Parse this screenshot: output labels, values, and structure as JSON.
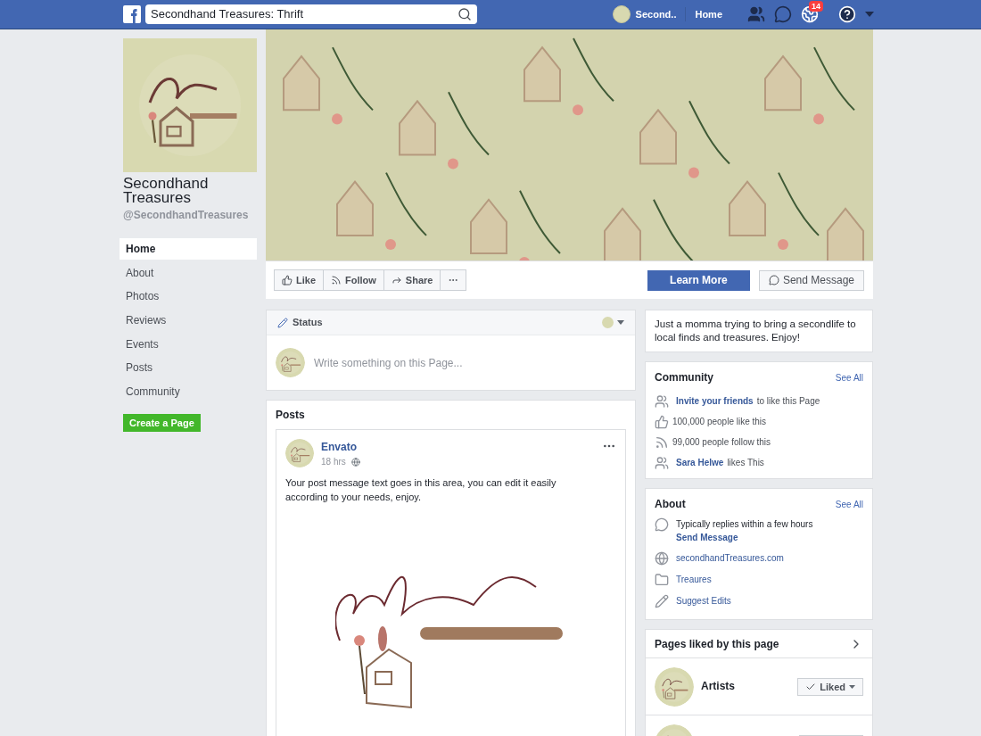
{
  "topbar": {
    "search_value": "Secondhand Treasures: Thrift",
    "profile_name": "Second..",
    "home": "Home",
    "notification_count": "14"
  },
  "page": {
    "name": "Secondhand Treasures",
    "handle": "@SecondhandTreasures",
    "create_button": "Create a Page"
  },
  "nav": [
    {
      "label": "Home",
      "selected": true
    },
    {
      "label": "About",
      "selected": false
    },
    {
      "label": "Photos",
      "selected": false
    },
    {
      "label": "Reviews",
      "selected": false
    },
    {
      "label": "Events",
      "selected": false
    },
    {
      "label": "Posts",
      "selected": false
    },
    {
      "label": "Community",
      "selected": false
    }
  ],
  "actions": {
    "buttons": [
      {
        "kind": "like",
        "label": "Like"
      },
      {
        "kind": "follow",
        "label": "Follow"
      },
      {
        "kind": "share",
        "label": "Share"
      },
      {
        "kind": "more"
      }
    ],
    "learn_more": "Learn More",
    "send_message": "Send Message"
  },
  "status": {
    "label": "Status",
    "placeholder": "Write something on this Page..."
  },
  "posts": {
    "title": "Posts",
    "post": {
      "author": "Envato",
      "time": "18 hrs",
      "text": "Your post message text goes in this area, you can edit it easily according to your needs, enjoy."
    }
  },
  "blurb": "Just a momma trying to bring a secondlife to local finds and treasures. Enjoy!",
  "community": {
    "title": "Community",
    "see_all": "See All",
    "rows": [
      {
        "kind": "people",
        "link": "Invite your friends",
        "text": "to like this Page"
      },
      {
        "kind": "like",
        "text": "100,000 people like this"
      },
      {
        "kind": "follow",
        "text": "99,000 people follow this"
      },
      {
        "kind": "people",
        "link": "Sara Helwe",
        "text": "likes This"
      }
    ]
  },
  "about": {
    "title": "About",
    "see_all": "See All",
    "rows": [
      {
        "kind": "messenger",
        "text": "Typically replies within a few hours",
        "link": "Send Message"
      },
      {
        "kind": "web",
        "link": "secondhandTreasures.com"
      },
      {
        "kind": "category",
        "link": "Treaures"
      },
      {
        "kind": "edit",
        "link": "Suggest Edits"
      }
    ]
  },
  "liked": {
    "title": "Pages liked by this page",
    "pages": [
      {
        "name": "Artists",
        "button": "Liked"
      },
      {
        "kind": "cut"
      }
    ]
  }
}
